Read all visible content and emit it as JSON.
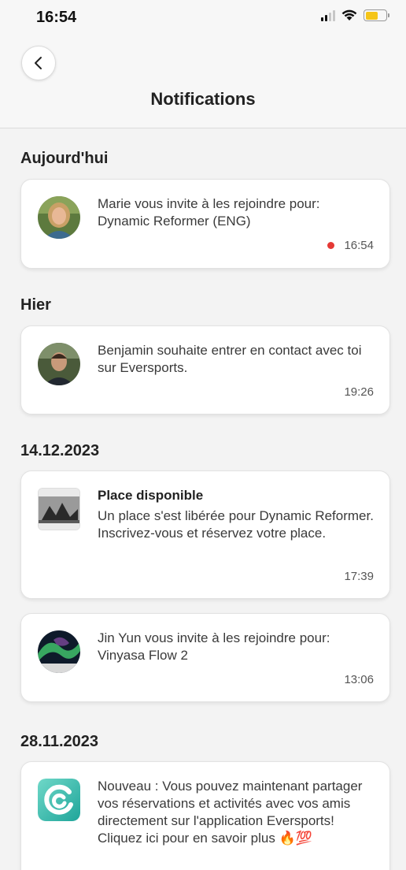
{
  "status_bar": {
    "time": "16:54"
  },
  "header": {
    "title": "Notifications"
  },
  "colors": {
    "unread": "#e53935",
    "battery": "#f5c518",
    "brand": "#2fb5a6"
  },
  "sections": [
    {
      "date": "Aujourd'hui",
      "items": [
        {
          "text": "Marie vous invite à les rejoindre pour: Dynamic Reformer (ENG)",
          "time": "16:54",
          "unread": true,
          "icon": "avatar-icon"
        }
      ]
    },
    {
      "date": "Hier",
      "items": [
        {
          "text": "Benjamin souhaite entrer en contact avec toi sur Eversports.",
          "time": "19:26",
          "unread": false,
          "icon": "avatar-icon"
        }
      ]
    },
    {
      "date": "14.12.2023",
      "items": [
        {
          "title": "Place disponible",
          "text": "Un place s'est libérée pour Dynamic Reformer. Inscrivez-vous et réservez votre place.",
          "time": "17:39",
          "unread": false,
          "icon": "class-photo-icon"
        },
        {
          "text": "Jin Yun vous invite à les rejoindre pour: Vinyasa Flow 2",
          "time": "13:06",
          "unread": false,
          "icon": "avatar-icon"
        }
      ]
    },
    {
      "date": "28.11.2023",
      "items": [
        {
          "text": "Nouveau : Vous pouvez maintenant partager vos réservations et activités avec vos amis directement sur l'application Eversports!",
          "text2": "Cliquez ici pour en savoir plus 🔥💯",
          "unread": false,
          "icon": "eversports-logo-icon"
        }
      ]
    }
  ]
}
